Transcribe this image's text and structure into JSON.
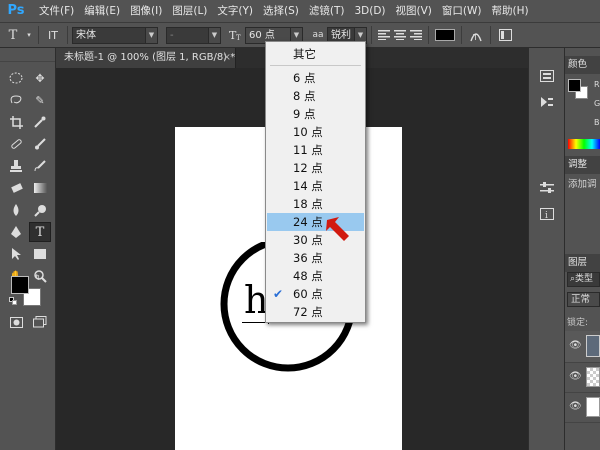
{
  "app": {
    "logo": "Ps"
  },
  "menubar": {
    "items": [
      {
        "label": "文件(F)"
      },
      {
        "label": "编辑(E)"
      },
      {
        "label": "图像(I)"
      },
      {
        "label": "图层(L)"
      },
      {
        "label": "文字(Y)"
      },
      {
        "label": "选择(S)"
      },
      {
        "label": "滤镜(T)"
      },
      {
        "label": "3D(D)"
      },
      {
        "label": "视图(V)"
      },
      {
        "label": "窗口(W)"
      },
      {
        "label": "帮助(H)"
      }
    ]
  },
  "options_bar": {
    "tool_icon_label": "T",
    "orient_label": "IT",
    "font_family": "宋体",
    "font_style": "-",
    "font_size": "60 点",
    "aa_icon": "aa",
    "antialias": "锐利",
    "color_swatch": "#000000"
  },
  "document": {
    "tab_title": "未标题-1 @ 100% (图层 1, RGB/8) *",
    "text_glyph": "h"
  },
  "font_size_menu": {
    "header": "其它",
    "items": [
      {
        "label": "6 点",
        "checked": false,
        "highlighted": false
      },
      {
        "label": "8 点",
        "checked": false,
        "highlighted": false
      },
      {
        "label": "9 点",
        "checked": false,
        "highlighted": false
      },
      {
        "label": "10 点",
        "checked": false,
        "highlighted": false
      },
      {
        "label": "11 点",
        "checked": false,
        "highlighted": false
      },
      {
        "label": "12 点",
        "checked": false,
        "highlighted": false
      },
      {
        "label": "14 点",
        "checked": false,
        "highlighted": false
      },
      {
        "label": "18 点",
        "checked": false,
        "highlighted": false
      },
      {
        "label": "24 点",
        "checked": false,
        "highlighted": true
      },
      {
        "label": "30 点",
        "checked": false,
        "highlighted": false
      },
      {
        "label": "36 点",
        "checked": false,
        "highlighted": false
      },
      {
        "label": "48 点",
        "checked": false,
        "highlighted": false
      },
      {
        "label": "60 点",
        "checked": true,
        "highlighted": false
      },
      {
        "label": "72 点",
        "checked": false,
        "highlighted": false
      }
    ]
  },
  "panels": {
    "color": {
      "tab": "颜色",
      "labels": [
        "R",
        "G",
        "B"
      ]
    },
    "adjust": {
      "tab": "调整",
      "hint": "添加调"
    },
    "layers": {
      "tab": "图层",
      "search": "类型",
      "blend": "正常",
      "lock": "锁定:"
    }
  },
  "colors": {
    "foreground": "#000000",
    "background": "#ffffff",
    "highlight": "#99c9ef",
    "arrow": "#d11a10"
  }
}
